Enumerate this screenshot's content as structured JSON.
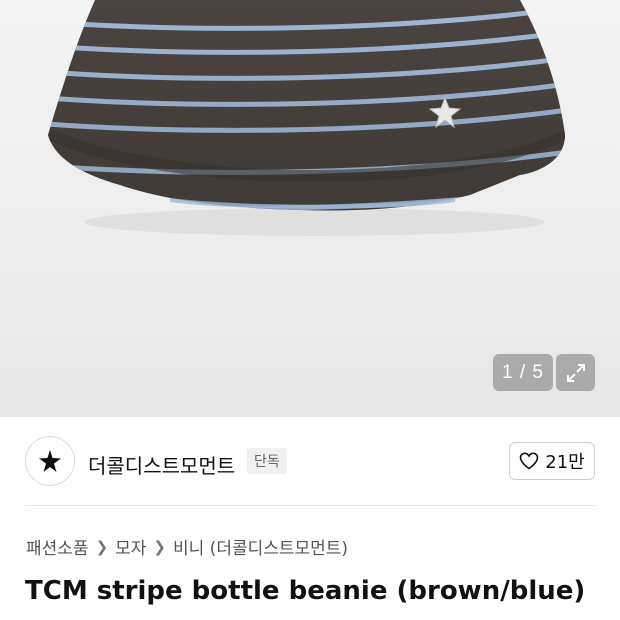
{
  "gallery": {
    "counter": "1 / 5",
    "expand_icon": "expand-arrows-icon"
  },
  "brand": {
    "logo_icon": "star-logo-icon",
    "name": "더콜디스트모먼트",
    "badge": "단독"
  },
  "like": {
    "icon": "heart-outline-icon",
    "count": "21만"
  },
  "breadcrumb": {
    "items": [
      "패션소품",
      "모자",
      "비니 (더콜디스트모먼트)"
    ]
  },
  "product": {
    "title": "TCM stripe bottle beanie (brown/blue)"
  },
  "colors": {
    "beanie_brown": "#4a433f",
    "stripe_blue": "#9fb8d6"
  }
}
